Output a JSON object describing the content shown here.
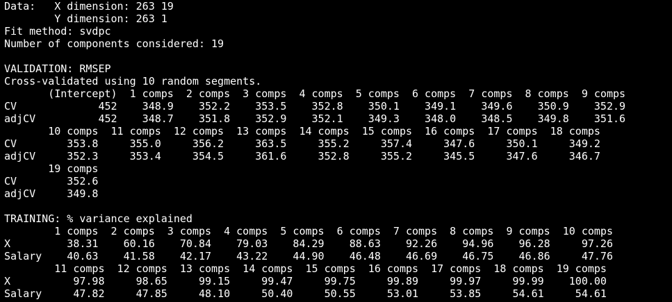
{
  "console": {
    "lines": [
      "Data:   X dimension: 263 19",
      "        Y dimension: 263 1",
      "Fit method: svdpc",
      "Number of components considered: 19",
      "",
      "VALIDATION: RMSEP",
      "Cross-validated using 10 random segments.",
      "       (Intercept)  1 comps  2 comps  3 comps  4 comps  5 comps  6 comps  7 comps  8 comps  9 comps",
      "CV             452    348.9    352.2    353.5    352.8    350.1    349.1    349.6    350.9    352.9",
      "adjCV          452    348.7    351.8    352.9    352.1    349.3    348.0    348.5    349.8    351.6",
      "       10 comps  11 comps  12 comps  13 comps  14 comps  15 comps  16 comps  17 comps  18 comps",
      "CV        353.8     355.0     356.2     363.5     355.2     357.4     347.6     350.1     349.2",
      "adjCV     352.3     353.4     354.5     361.6     352.8     355.2     345.5     347.6     346.7",
      "       19 comps",
      "CV        352.6",
      "adjCV     349.8",
      "",
      "TRAINING: % variance explained",
      "        1 comps  2 comps  3 comps  4 comps  5 comps  6 comps  7 comps  8 comps  9 comps  10 comps",
      "X         38.31    60.16    70.84    79.03    84.29    88.63    92.26    94.96    96.28     97.26",
      "Salary    40.63    41.58    42.17    43.22    44.90    46.48    46.69    46.75    46.86     47.76",
      "        11 comps  12 comps  13 comps  14 comps  15 comps  16 comps  17 comps  18 comps  19 comps",
      "X          97.98     98.65     99.15     99.47     99.75     99.89     99.97     99.99    100.00",
      "Salary     47.82     47.85     48.10     50.40     50.55     53.01     53.85     54.61     54.61"
    ]
  }
}
